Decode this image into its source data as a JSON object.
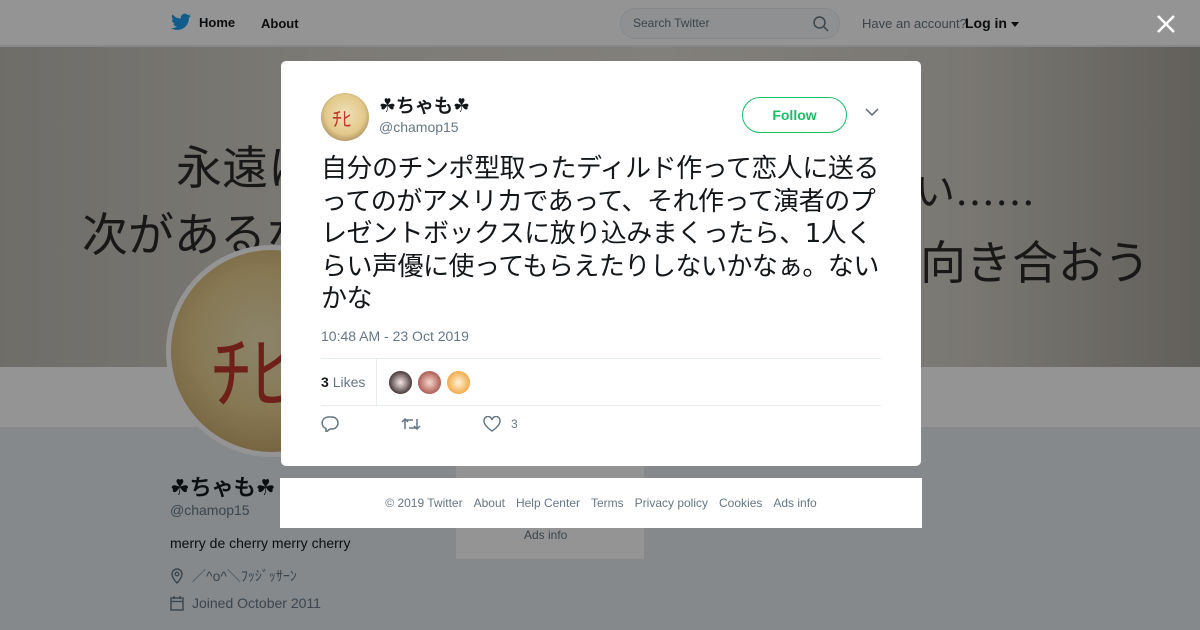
{
  "nav": {
    "home_label": "Home",
    "about_label": "About",
    "search_placeholder": "Search Twitter",
    "have_account": "Have an account?",
    "login_label": "Log in"
  },
  "banner": {
    "line1": "永遠に",
    "line2": "次があるな",
    "line3": "い……",
    "line4": "向き合おう"
  },
  "profile": {
    "name": "☘ちゃも☘",
    "handle": "@chamop15",
    "bio": "merry de cherry merry cherry",
    "location": "／^o^＼ﾌｯｼﾞｯｻｰﾝ",
    "joined": "Joined October 2011",
    "side_ads": "Ads info"
  },
  "tweet": {
    "name": "☘ちゃも☘",
    "handle": "@chamop15",
    "follow_label": "Follow",
    "text": "自分のチンポ型取ったディルド作って恋人に送るってのがアメリカであって、それ作って演者のプレゼントボックスに放り込みまくったら、1人くらい声優に使ってもらえたりしないかなぁ。ないかな",
    "timestamp": "10:48 AM - 23 Oct 2019",
    "likes_count": "3",
    "likes_label": "Likes",
    "like_action_count": "3"
  },
  "footer": {
    "links": [
      "© 2019 Twitter",
      "About",
      "Help Center",
      "Terms",
      "Privacy policy",
      "Cookies",
      "Ads info"
    ]
  },
  "colors": {
    "follow_green": "#17bf63",
    "twitter_blue": "#1da1f2",
    "muted_text": "#657786"
  }
}
